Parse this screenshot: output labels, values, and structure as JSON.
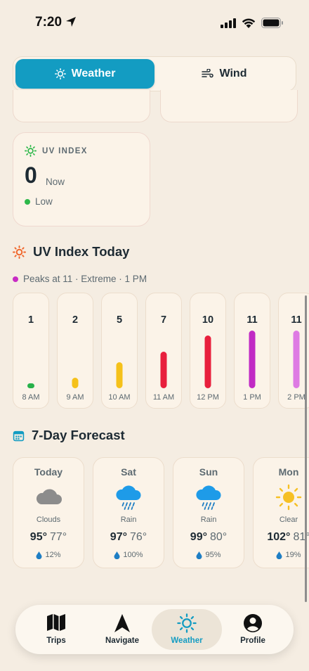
{
  "status": {
    "time": "7:20"
  },
  "segments": [
    {
      "label": "Weather",
      "active": true,
      "icon": "sun-icon"
    },
    {
      "label": "Wind",
      "active": false,
      "icon": "wind-icon"
    }
  ],
  "uv_card": {
    "title": "UV INDEX",
    "value": "0",
    "suffix": "Now",
    "level": "Low",
    "level_color": "#2db84a"
  },
  "uv_today": {
    "title": "UV Index Today",
    "peak": "Peaks at 11 · Extreme · 1 PM",
    "peak_color": "#c82bc4",
    "hours": [
      {
        "value": "1",
        "time": "8 AM",
        "fill": 0.09,
        "color": "#27b14a"
      },
      {
        "value": "2",
        "time": "9 AM",
        "fill": 0.18,
        "color": "#f5c11a"
      },
      {
        "value": "5",
        "time": "10 AM",
        "fill": 0.45,
        "color": "#f5c11a"
      },
      {
        "value": "7",
        "time": "11 AM",
        "fill": 0.64,
        "color": "#e81f3d"
      },
      {
        "value": "10",
        "time": "12 PM",
        "fill": 0.91,
        "color": "#e81f3d"
      },
      {
        "value": "11",
        "time": "1 PM",
        "fill": 1.0,
        "color": "#c02ac4"
      },
      {
        "value": "11",
        "time": "2 PM",
        "fill": 1.0,
        "color": "#de7ae3"
      }
    ]
  },
  "forecast": {
    "title": "7-Day Forecast",
    "days": [
      {
        "day": "Today",
        "condition": "Clouds",
        "high": "95°",
        "low": "77°",
        "precip": "12%",
        "icon": "cloud-icon"
      },
      {
        "day": "Sat",
        "condition": "Rain",
        "high": "97°",
        "low": "76°",
        "precip": "100%",
        "icon": "rain-cloud-icon"
      },
      {
        "day": "Sun",
        "condition": "Rain",
        "high": "99°",
        "low": "80°",
        "precip": "95%",
        "icon": "rain-cloud-icon"
      },
      {
        "day": "Mon",
        "condition": "Clear",
        "high": "102°",
        "low": "81°",
        "precip": "19%",
        "icon": "sun-icon"
      }
    ]
  },
  "tabs": [
    {
      "label": "Trips",
      "icon": "map-icon",
      "active": false
    },
    {
      "label": "Navigate",
      "icon": "navigation-arrow-icon",
      "active": false
    },
    {
      "label": "Weather",
      "icon": "sun-icon",
      "active": true
    },
    {
      "label": "Profile",
      "icon": "person-icon",
      "active": false
    }
  ],
  "colors": {
    "accent": "#139cc2",
    "background": "#f5ede2",
    "card": "#fbf3e8",
    "sun_orange": "#f06428",
    "uv_green": "#2db84a"
  }
}
